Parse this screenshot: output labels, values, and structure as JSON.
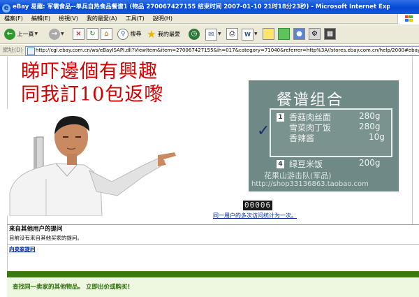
{
  "window": {
    "title": "eBay 易趣: 军需食品--单兵自热食品餐谱1 (物品 270067427155 结束时间 2007-01-10 21时18分23秒) - Microsoft Internet Explorer"
  },
  "menu": [
    "檔案(F)",
    "編輯(E)",
    "檢視(V)",
    "我的最愛(A)",
    "工具(T)",
    "說明(H)"
  ],
  "toolbar": {
    "back_label": "上一頁",
    "search_label": "搜尋",
    "favorites_label": "我的最愛"
  },
  "address": {
    "label": "網址(D)",
    "url": "http://cgi.ebay.com.cn/ws/eBayISAPI.dll?ViewItem&item=270067427155&ih=017&category=71040&referrer=http%3A//stores.ebay.com.cn/help/2000#ebayphotohosting"
  },
  "listing": {
    "sign_line1": "睇吓邊個有興趣",
    "sign_line2": "同我訂10包返嚟",
    "menu_image": {
      "title": "餐谱组合",
      "section1": {
        "number": "1",
        "items": [
          {
            "name": "香菇肉丝面",
            "weight": "280g"
          },
          {
            "name": "雪菜肉丁饭",
            "weight": "280g"
          },
          {
            "name": "香辣酱",
            "weight": "10g"
          }
        ]
      },
      "section4": {
        "number": "4",
        "items": [
          {
            "name": "绿豆米饭",
            "weight": "200g"
          }
        ]
      },
      "watermark1": "花果山游击队(军品)",
      "watermark2": "http://shop33136863.taobao.com"
    },
    "counter": "00006",
    "counter_note": "同一用户的多次访问统计为一次。"
  },
  "questions": {
    "header": "来自其他用户的提问",
    "empty_text": "目前没有来自其他买家的提问。",
    "ask_link": "向卖家提问"
  },
  "footer": {
    "text": "查找同一卖家的其他物品。 立即出价或购买!"
  },
  "colors": {
    "titlebar": "#0a50d8",
    "chrome": "#ece9d8",
    "sign_red": "#d40000",
    "footer_green": "#3a7a10",
    "link_blue": "#002a9c"
  }
}
